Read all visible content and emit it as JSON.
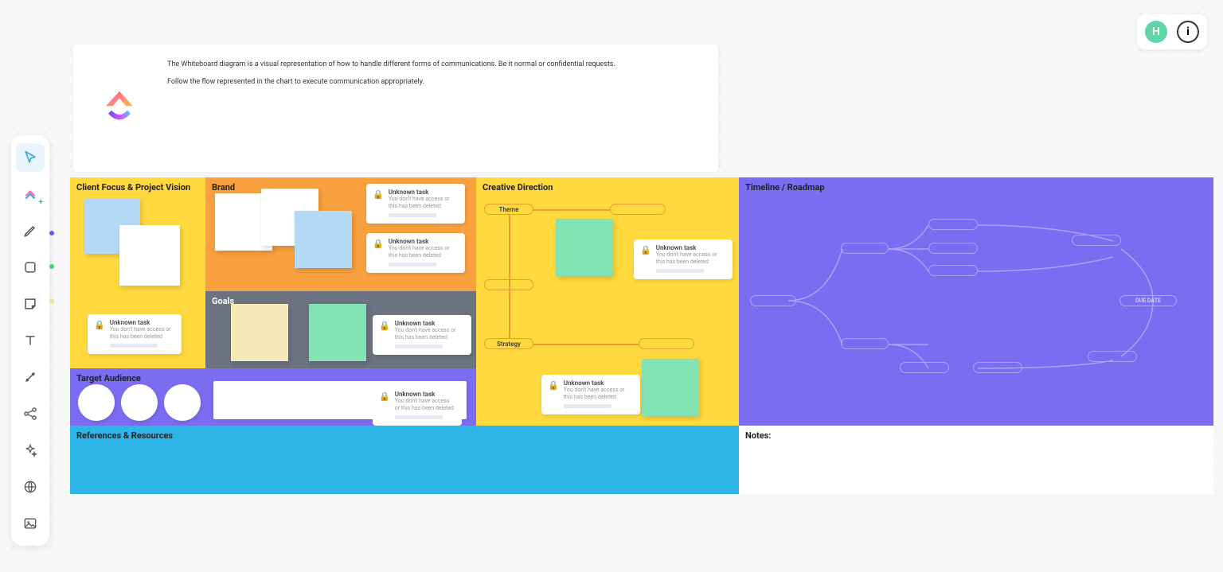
{
  "topbar": {
    "avatar_initial": "H"
  },
  "intro": {
    "line1": "The Whiteboard diagram is a visual representation of how to handle different forms of communications. Be it normal or confidential requests.",
    "line2": "Follow the flow represented in the chart to execute communication appropriately."
  },
  "sections": {
    "client_focus": "Client Focus & Project Vision",
    "brand": "Brand",
    "goals": "Goals",
    "target": "Target Audience",
    "creative": "Creative Direction",
    "timeline": "Timeline / Roadmap",
    "references": "References & Resources",
    "notes": "Notes:"
  },
  "task_card": {
    "title": "Unknown task",
    "sub": "You don't have access or this has been deleted"
  },
  "creative_flow": {
    "theme": "Theme",
    "strategy": "Strategy"
  },
  "timeline": {
    "due_date": "DUE DATE"
  },
  "colors": {
    "yellow": "#ffd93d",
    "orange": "#f9a03f",
    "gray": "#6b7280",
    "purple": "#7c6cf2",
    "cyan": "#2db5e8",
    "mint": "#84e3b5",
    "lightblue": "#b3d9f5",
    "cream": "#f5e9b8"
  }
}
